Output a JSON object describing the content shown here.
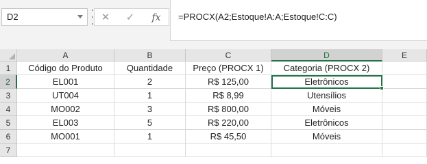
{
  "name_box": {
    "value": "D2"
  },
  "formula_bar": {
    "cancel_icon": "cancel-icon",
    "enter_icon": "enter-icon",
    "fx_label": "fx",
    "formula": "=PROCX(A2;Estoque!A:A;Estoque!C:C)"
  },
  "columns": [
    "A",
    "B",
    "C",
    "D",
    "E"
  ],
  "rows": [
    {
      "num": "1",
      "cells": [
        "Código do Produto",
        "Quantidade",
        "Preço (PROCX 1)",
        "Categoria (PROCX 2)",
        ""
      ]
    },
    {
      "num": "2",
      "cells": [
        "EL001",
        "2",
        "R$ 125,00",
        "Eletrônicos",
        ""
      ]
    },
    {
      "num": "3",
      "cells": [
        "UT004",
        "1",
        "R$ 8,99",
        "Utensílios",
        ""
      ]
    },
    {
      "num": "4",
      "cells": [
        "MO002",
        "3",
        "R$ 800,00",
        "Móveis",
        ""
      ]
    },
    {
      "num": "5",
      "cells": [
        "EL003",
        "5",
        "R$ 220,00",
        "Eletrônicos",
        ""
      ]
    },
    {
      "num": "6",
      "cells": [
        "MO001",
        "1",
        "R$ 45,50",
        "Móveis",
        ""
      ]
    },
    {
      "num": "7",
      "cells": [
        "",
        "",
        "",
        "",
        ""
      ]
    }
  ],
  "selected_cell": "D2",
  "accent_color": "#217346"
}
